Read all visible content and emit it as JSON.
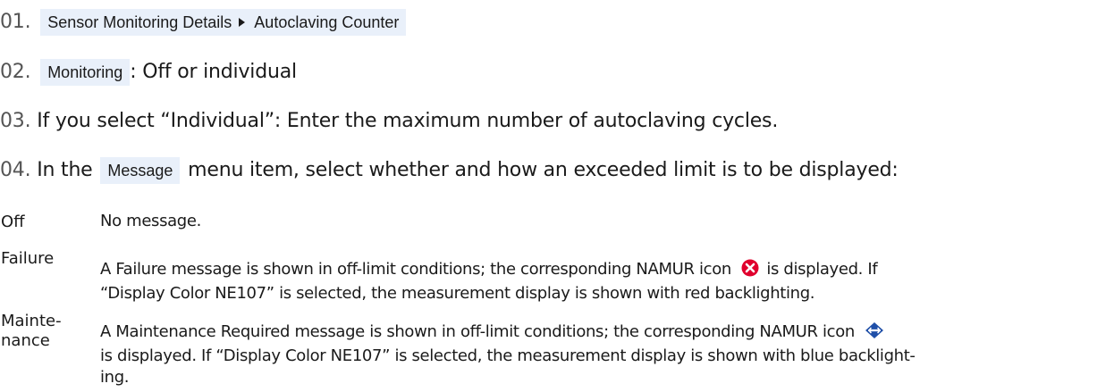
{
  "steps": [
    {
      "num": "01.",
      "path_item_1": "Sensor Monitoring Details",
      "path_item_2": "Autoclaving Counter"
    },
    {
      "num": "02.",
      "menu_item": "Monitoring",
      "text": ": Off or individual"
    },
    {
      "num": "03.",
      "text": "If you select “Individual”: Enter the maximum number of autoclaving cycles."
    },
    {
      "num": "04.",
      "text_before": "In the",
      "menu_item": "Message",
      "text_after": "menu item, select whether and how an exceeded limit is to be displayed:"
    }
  ],
  "options": [
    {
      "term": "Off",
      "description": "No message."
    },
    {
      "term": "Failure",
      "desc_before_icon": "A Failure message is shown in off-limit conditions; the corresponding NAMUR icon",
      "desc_after_icon": "is displayed. If",
      "desc_line2": "“Display Color NE107” is selected, the measurement display is shown with red backlighting.",
      "icon": "namur-failure-icon"
    },
    {
      "term_line1": "Mainte-",
      "term_line2": "nance",
      "desc_before_icon": "A Maintenance Required message is shown in off-limit conditions; the corresponding NAMUR icon",
      "desc_line2": "is displayed. If “Display Color NE107” is selected, the measurement display is shown with blue backlight-",
      "desc_line3": "ing.",
      "icon": "namur-maintenance-icon"
    }
  ],
  "colors": {
    "highlight_bg": "#e9f0fa",
    "failure_icon": "#e0002d",
    "maintenance_icon": "#1f4fa8"
  }
}
